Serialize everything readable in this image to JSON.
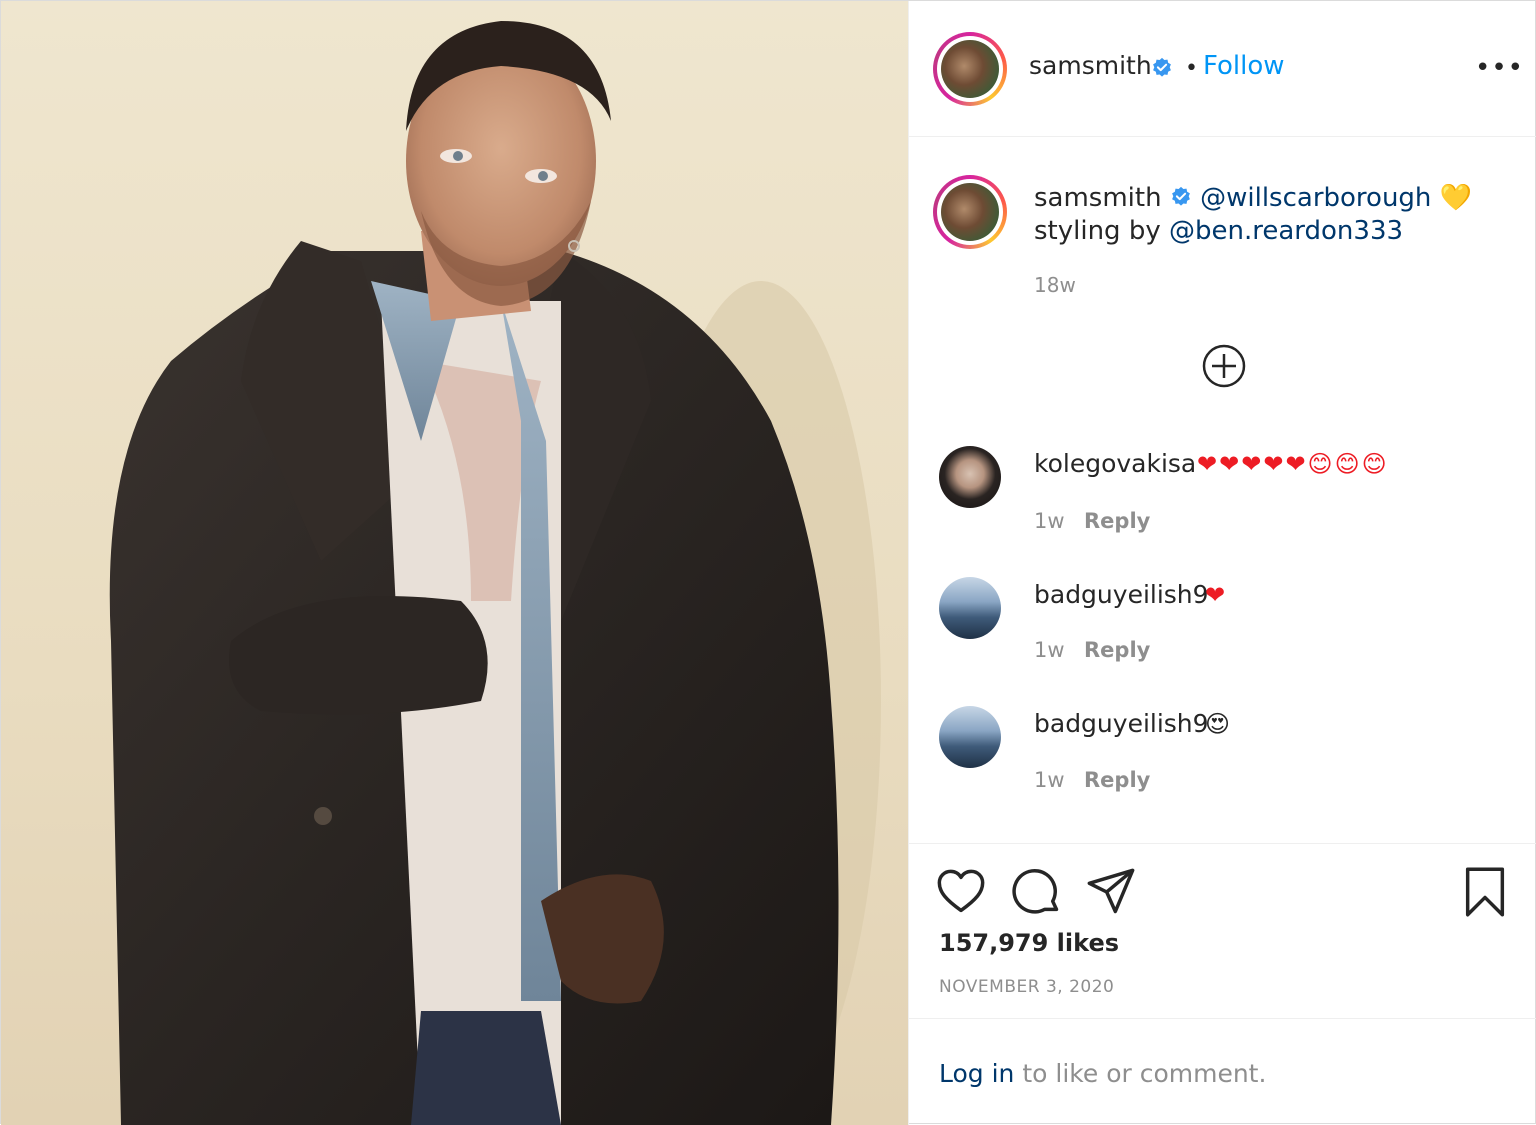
{
  "post": {
    "author": "samsmith",
    "follow_label": "Follow",
    "more_label": "•••",
    "separator": "•"
  },
  "caption": {
    "username": "samsmith",
    "mention_1": "@willscarborough",
    "emoji": "💛",
    "line2_prefix": "styling by ",
    "mention_2": "@ben.reardon333",
    "time": "18w"
  },
  "comments": [
    {
      "username": "kolegovakisa",
      "text": "❤❤❤❤❤😊😊😊",
      "time": "1w",
      "reply": "Reply"
    },
    {
      "username": "badguyeilish9",
      "text": "❤",
      "time": "1w",
      "reply": "Reply"
    },
    {
      "username": "badguyeilish9",
      "text": "😍",
      "time": "1w",
      "reply": "Reply"
    }
  ],
  "stats": {
    "likes": "157,979 likes",
    "date": "NOVEMBER 3, 2020"
  },
  "login": {
    "link": "Log in",
    "rest": " to like or comment."
  },
  "colors": {
    "link_blue": "#0095f6",
    "mention_blue": "#00376b",
    "verified_blue": "#3897f0",
    "muted": "#8e8e8e",
    "heart_red": "#ed1c24"
  },
  "icons": [
    "verified-badge-icon",
    "more-options-icon",
    "load-more-comments-icon",
    "like-heart-icon",
    "comment-icon",
    "share-icon",
    "save-bookmark-icon"
  ]
}
